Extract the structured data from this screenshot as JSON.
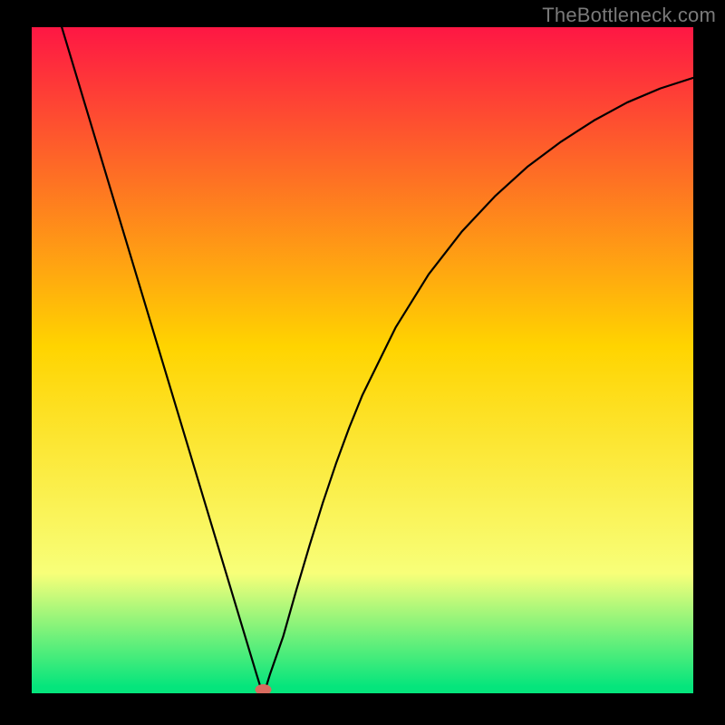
{
  "watermark": "TheBottleneck.com",
  "chart_data": {
    "type": "line",
    "title": "",
    "xlabel": "",
    "ylabel": "",
    "xlim": [
      0,
      1
    ],
    "ylim": [
      0,
      1
    ],
    "x": [
      0.0,
      0.02,
      0.04,
      0.06,
      0.08,
      0.1,
      0.12,
      0.14,
      0.16,
      0.18,
      0.2,
      0.22,
      0.24,
      0.26,
      0.28,
      0.3,
      0.31,
      0.32,
      0.33,
      0.34,
      0.345,
      0.35,
      0.355,
      0.36,
      0.38,
      0.4,
      0.42,
      0.44,
      0.46,
      0.48,
      0.5,
      0.55,
      0.6,
      0.65,
      0.7,
      0.75,
      0.8,
      0.85,
      0.9,
      0.95,
      1.0
    ],
    "values": [
      1.15,
      1.084,
      1.018,
      0.952,
      0.886,
      0.82,
      0.754,
      0.688,
      0.622,
      0.556,
      0.49,
      0.424,
      0.358,
      0.292,
      0.226,
      0.16,
      0.127,
      0.094,
      0.061,
      0.028,
      0.012,
      0.002,
      0.012,
      0.028,
      0.085,
      0.155,
      0.222,
      0.286,
      0.345,
      0.399,
      0.448,
      0.549,
      0.629,
      0.693,
      0.746,
      0.791,
      0.828,
      0.86,
      0.887,
      0.908,
      0.924
    ],
    "marker": {
      "x": 0.35,
      "y": 0.0
    },
    "background_gradient_top": "#fe1744",
    "background_gradient_mid": "#ffd400",
    "background_gradient_low": "#f8ff79",
    "background_gradient_bottom": "#05e57c",
    "line_color": "#000000",
    "marker_color": "#d96b5f"
  }
}
